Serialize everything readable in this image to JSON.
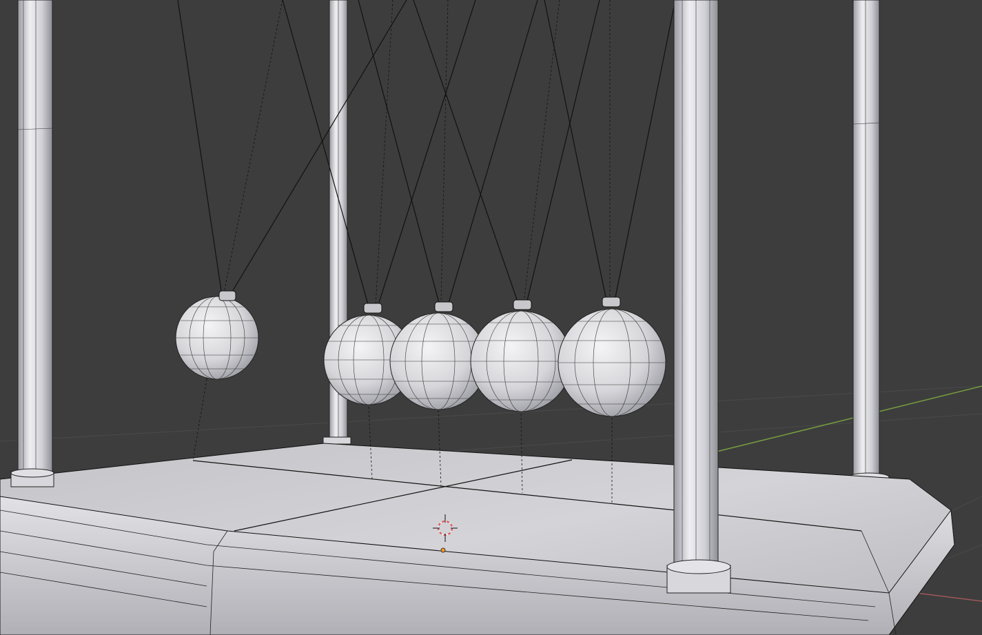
{
  "app": {
    "view": "3D Viewport",
    "shading": "solid-wireframe"
  },
  "scene": {
    "subject": "newtons-cradle",
    "pendulum_count": 5,
    "pendulums_raised": 1,
    "posts": 4
  },
  "colors": {
    "background": "#3d3d3d",
    "grid_line": "#4a4a4a",
    "x_axis": "#a0585a",
    "y_axis": "#78a040",
    "mesh_fill": "#d8d8dc",
    "mesh_shadow": "#9a9aa2",
    "wire": "#101010",
    "cursor_ring": "#e05050",
    "origin_dot": "#ff9a20"
  },
  "icons": {
    "cursor": "3d-cursor-icon",
    "origin": "object-origin-icon"
  }
}
